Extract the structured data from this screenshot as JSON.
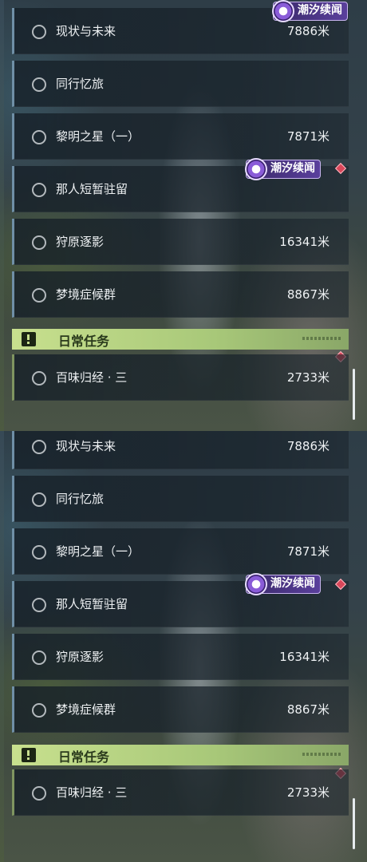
{
  "panels": [
    {
      "tasks": [
        {
          "name": "现状与未来",
          "distance": "7886米"
        },
        {
          "name": "同行忆旅",
          "distance": ""
        },
        {
          "name": "黎明之星（一）",
          "distance": "7871米"
        },
        {
          "name": "那人短暂驻留",
          "distance": ""
        },
        {
          "name": "狩原逐影",
          "distance": "16341米"
        },
        {
          "name": "梦境症候群",
          "distance": "8867米"
        }
      ],
      "badges": [
        "潮汐续闻",
        "潮汐续闻"
      ],
      "section": {
        "title": "日常任务"
      },
      "daily": [
        {
          "name": "百味归经 · 三",
          "distance": "2733米"
        }
      ]
    },
    {
      "tasks": [
        {
          "name": "现状与未来",
          "distance": "7886米"
        },
        {
          "name": "同行忆旅",
          "distance": ""
        },
        {
          "name": "黎明之星（一）",
          "distance": "7871米"
        },
        {
          "name": "那人短暂驻留",
          "distance": ""
        },
        {
          "name": "狩原逐影",
          "distance": "16341米"
        },
        {
          "name": "梦境症候群",
          "distance": "8867米"
        }
      ],
      "badges": [
        "潮汐续闻"
      ],
      "section": {
        "title": "日常任务"
      },
      "daily": [
        {
          "name": "百味归经 · 三",
          "distance": "2733米"
        }
      ]
    }
  ],
  "colors": {
    "accent_quest": "#6f8fa6",
    "accent_daily": "#a8c879",
    "badge_purple": "#5a3f9c",
    "marker_red": "#d9475a"
  },
  "icons": [
    "circle-status-icon",
    "tide-badge-icon",
    "diamond-marker-icon",
    "exclamation-icon"
  ]
}
